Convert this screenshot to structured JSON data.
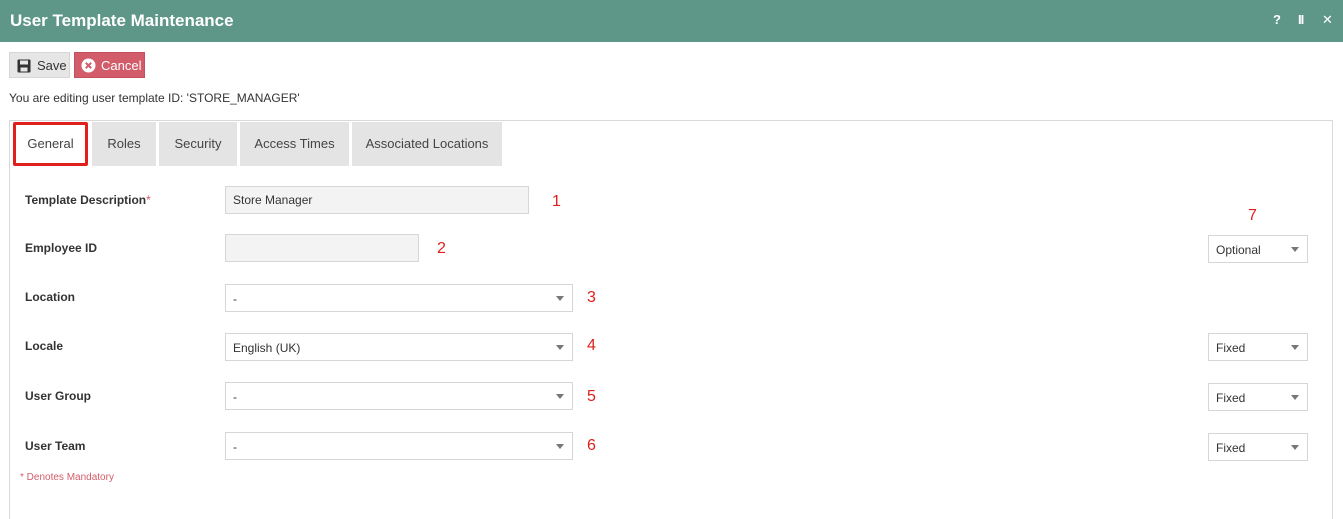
{
  "window": {
    "title": "User Template Maintenance",
    "controls": [
      "?",
      "II",
      "✕"
    ]
  },
  "toolbar": {
    "save_label": "Save",
    "cancel_label": "Cancel"
  },
  "editing_message": "You are editing user template ID: 'STORE_MANAGER'",
  "tabs": [
    {
      "label": "General",
      "active": true
    },
    {
      "label": "Roles",
      "active": false
    },
    {
      "label": "Security",
      "active": false
    },
    {
      "label": "Access Times",
      "active": false
    },
    {
      "label": "Associated Locations",
      "active": false
    }
  ],
  "form": {
    "template_description": {
      "label": "Template Description",
      "required_mark": "*",
      "value": "Store Manager",
      "marker": "1"
    },
    "employee_id": {
      "label": "Employee ID",
      "value": "",
      "marker": "2",
      "option": "Optional",
      "option_marker": "7"
    },
    "location": {
      "label": "Location",
      "value": "-",
      "marker": "3"
    },
    "locale": {
      "label": "Locale",
      "value": "English (UK)",
      "marker": "4",
      "option": "Fixed"
    },
    "user_group": {
      "label": "User Group",
      "value": "-",
      "marker": "5",
      "option": "Fixed"
    },
    "user_team": {
      "label": "User Team",
      "value": "-",
      "marker": "6",
      "option": "Fixed"
    }
  },
  "mandatory_note": "* Denotes Mandatory",
  "colors": {
    "titlebar": "#5e9787",
    "cancel": "#d25c6a",
    "highlight": "#e0201c"
  },
  "icons": {
    "save": "floppy-disk-icon",
    "cancel": "x-circle-icon"
  }
}
